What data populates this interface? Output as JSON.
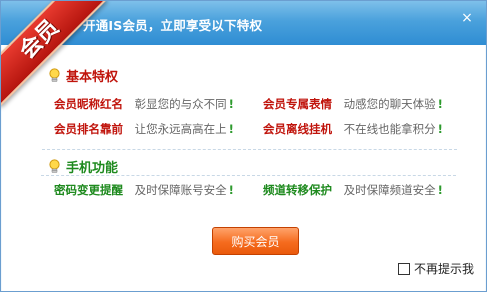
{
  "window": {
    "title": "开通IS会员，立即享受以下特权",
    "ribbon": "会员",
    "close_icon": "×"
  },
  "colors": {
    "basic_accent": "#c0140c",
    "mobile_accent": "#1e8a1e"
  },
  "sections": [
    {
      "icon": "lightbulb-icon",
      "title": "基本特权",
      "items": [
        {
          "name": "会员昵称红名",
          "desc": "彰显您的与众不同",
          "excl": "!"
        },
        {
          "name": "会员专属表情",
          "desc": "动感您的聊天体验",
          "excl": "!"
        },
        {
          "name": "会员排名靠前",
          "desc": "让您永远高高在上",
          "excl": "!"
        },
        {
          "name": "会员离线挂机",
          "desc": "不在线也能拿积分",
          "excl": "!"
        }
      ]
    },
    {
      "icon": "lightbulb-icon",
      "title": "手机功能",
      "items": [
        {
          "name": "密码变更提醒",
          "desc": "及时保障账号安全",
          "excl": "!"
        },
        {
          "name": "频道转移保护",
          "desc": "及时保障频道安全",
          "excl": "!"
        }
      ]
    }
  ],
  "buy_button": "购买会员",
  "no_more_tips": "不再提示我"
}
